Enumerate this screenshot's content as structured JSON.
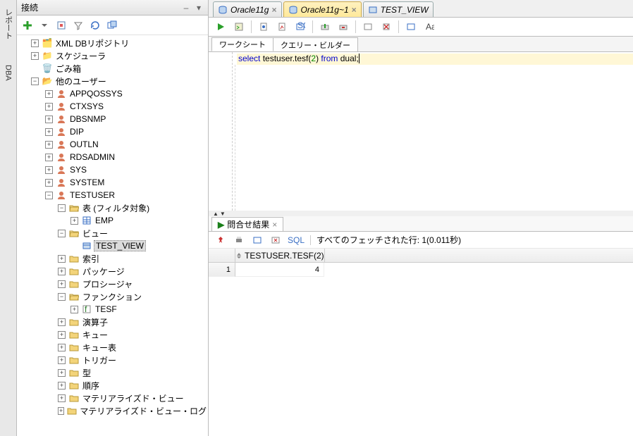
{
  "vertical_tabs": [
    "レポート",
    "DBA"
  ],
  "panel_title": "接続",
  "tree": {
    "xmlrepo": "XML DBリポジトリ",
    "scheduler": "スケジューラ",
    "trash": "ごみ箱",
    "other_users": "他のユーザー",
    "users": [
      "APPQOSSYS",
      "CTXSYS",
      "DBSNMP",
      "DIP",
      "OUTLN",
      "RDSADMIN",
      "SYS",
      "SYSTEM",
      "TESTUSER"
    ],
    "tables_filtered": "表 (フィルタ対象)",
    "emp": "EMP",
    "views": "ビュー",
    "test_view": "TEST_VIEW",
    "indexes": "索引",
    "packages": "パッケージ",
    "procedures": "プロシージャ",
    "functions": "ファンクション",
    "tesf": "TESF",
    "operators": "演算子",
    "queues": "キュー",
    "queue_tables": "キュー表",
    "triggers": "トリガー",
    "types": "型",
    "sequences": "順序",
    "mviews": "マテリアライズド・ビュー",
    "mview_logs": "マテリアライズド・ビュー・ログ"
  },
  "file_tabs": [
    {
      "label": "Oracle11g",
      "active": false
    },
    {
      "label": "Oracle11g~1",
      "active": true
    },
    {
      "label": "TEST_VIEW",
      "active": false
    }
  ],
  "sub_tabs": [
    "ワークシート",
    "クエリー・ビルダー"
  ],
  "sql": {
    "kw1": "select",
    "mid": " testuser.tesf(",
    "num": "2",
    "mid2": ") ",
    "kw2": "from",
    "tail": " dual;"
  },
  "result_tab": "問合せ結果",
  "result_tb": {
    "sql": "SQL",
    "status": "すべてのフェッチされた行: 1(0.011秒)"
  },
  "grid": {
    "col": "TESTUSER.TESF(2)",
    "row_num": "1",
    "value": "4"
  }
}
